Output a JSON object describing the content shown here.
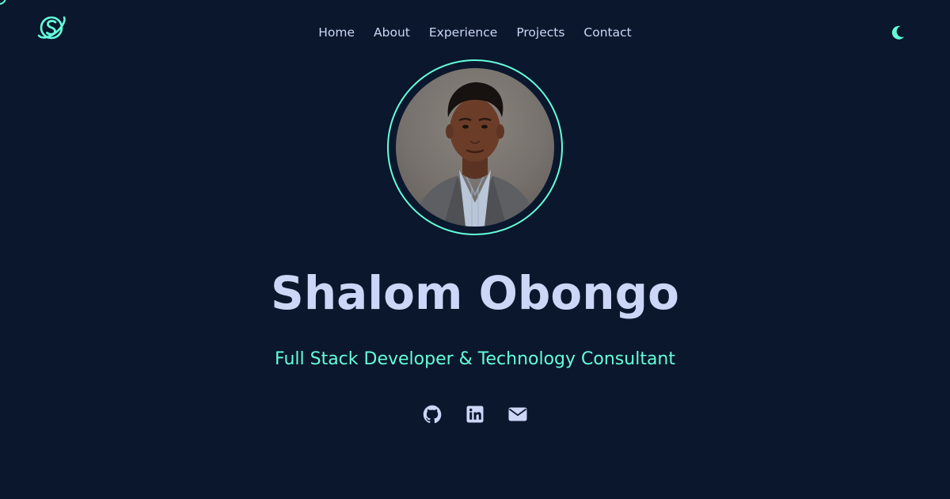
{
  "brand": {
    "logo_icon": "planet-s-logo-icon",
    "accent_color": "#64ffda",
    "background_color": "#0b172d",
    "text_color": "#ccd6f6"
  },
  "nav": {
    "items": [
      {
        "label": "Home"
      },
      {
        "label": "About"
      },
      {
        "label": "Experience"
      },
      {
        "label": "Projects"
      },
      {
        "label": "Contact"
      }
    ],
    "theme_toggle_icon": "moon-icon"
  },
  "hero": {
    "avatar_alt": "Shalom Obongo",
    "name": "Shalom Obongo",
    "tagline": "Full Stack Developer & Technology Consultant",
    "socials": [
      {
        "icon": "github-icon"
      },
      {
        "icon": "linkedin-icon"
      },
      {
        "icon": "mail-icon"
      }
    ]
  }
}
